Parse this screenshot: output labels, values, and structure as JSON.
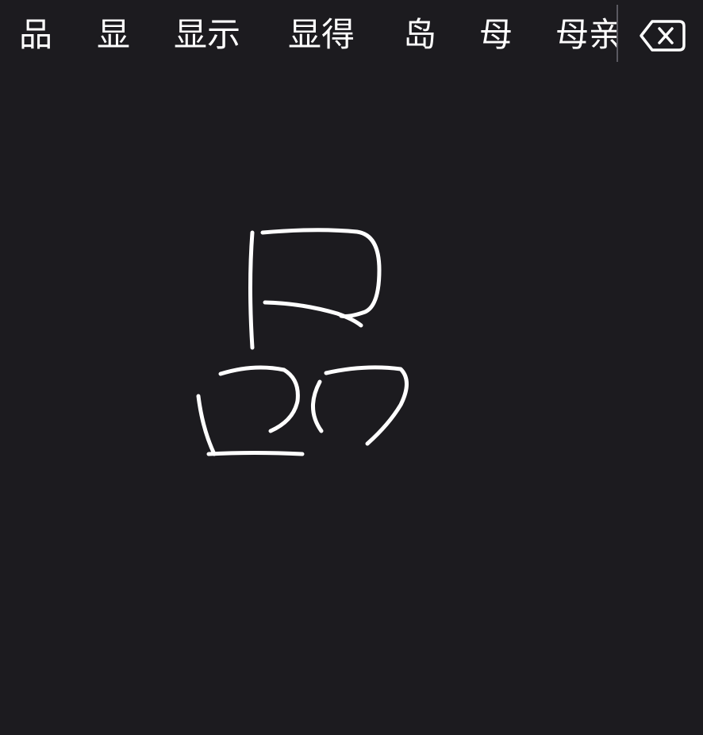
{
  "candidates": [
    "品",
    "显",
    "显示",
    "显得",
    "岛",
    "母",
    "母亲"
  ],
  "backspace_icon": "backspace-icon",
  "colors": {
    "background": "#1c1b1f",
    "text": "#ffffff",
    "ink": "#ffffff",
    "divider": "#5a5960"
  }
}
